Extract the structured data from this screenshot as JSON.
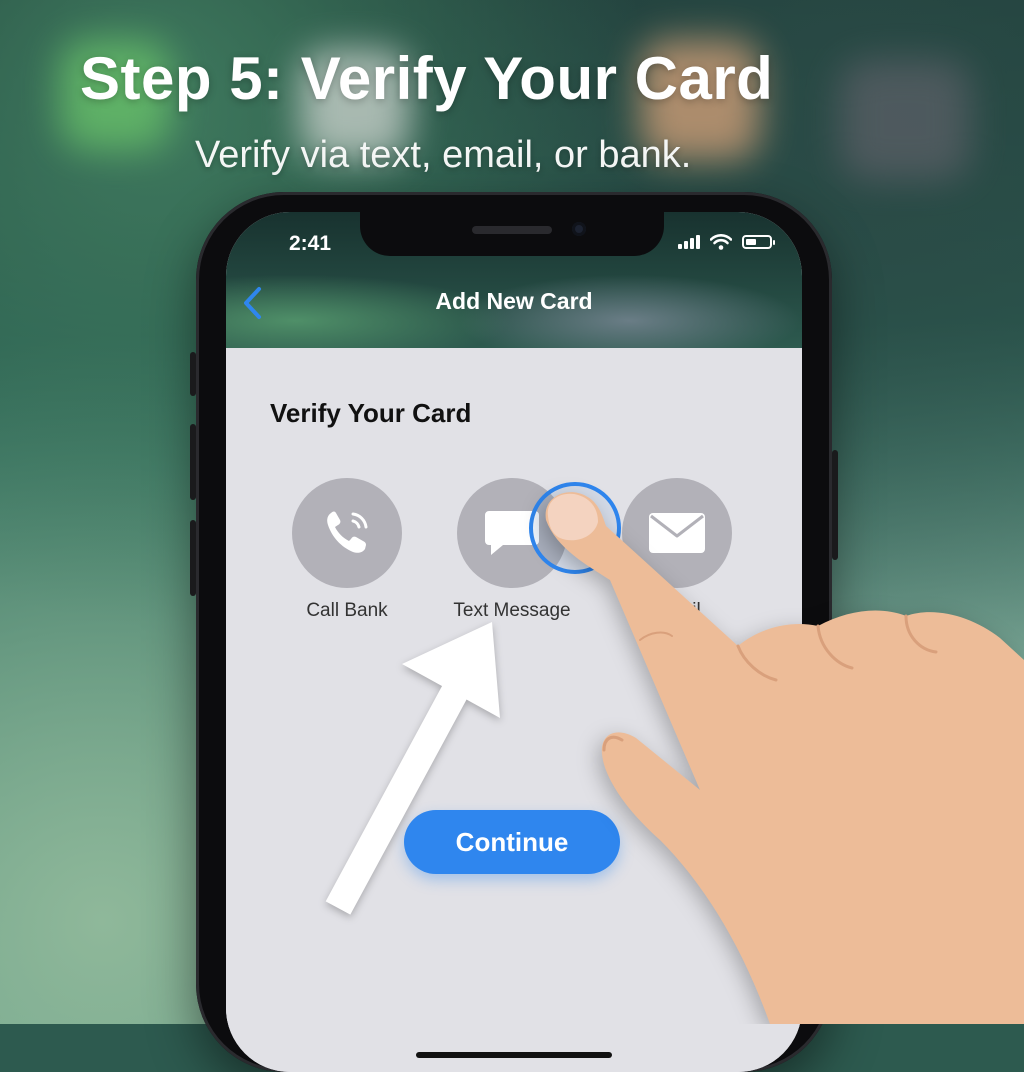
{
  "headline": "Step 5: Verify Your Card",
  "subheadline": "Verify via text, email, or bank.",
  "status_bar": {
    "time": "2:41"
  },
  "nav": {
    "title": "Add New Card",
    "back_icon": "chevron-left-icon"
  },
  "screen": {
    "section_title": "Verify Your Card",
    "options": [
      {
        "label": "Call Bank",
        "icon": "phone-icon"
      },
      {
        "label": "Text Message",
        "icon": "message-bubble-icon",
        "selected": true
      },
      {
        "label": "Email",
        "icon": "envelope-icon"
      }
    ],
    "continue_label": "Continue"
  },
  "colors": {
    "accent": "#2f86ee",
    "option_circle": "#b2b1b8",
    "screen_bg": "#e1e1e6"
  }
}
